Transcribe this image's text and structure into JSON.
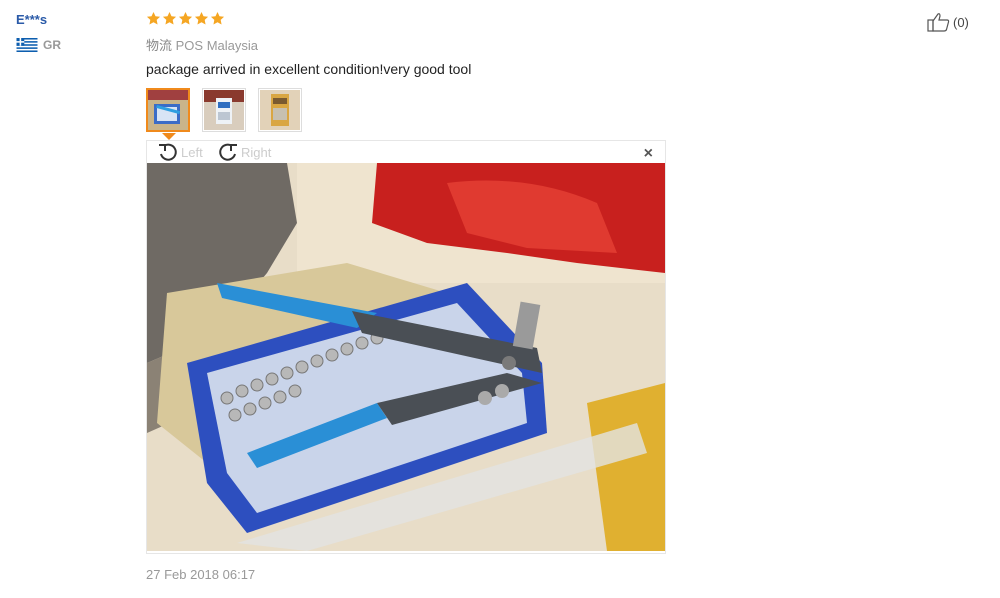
{
  "review": {
    "user_name": "E***s",
    "country_code": "GR",
    "rating": 5,
    "logistics_label": "物流",
    "logistics_value": "POS Malaysia",
    "text": "package arrived in excellent condition!very good tool",
    "date": "27 Feb 2018 06:17",
    "helpful_count": "(0)"
  },
  "viewer": {
    "rotate_left_label": "Left",
    "rotate_right_label": "Right",
    "close_label": "×"
  },
  "icons": {
    "flag": "greece-flag-icon",
    "star": "star-icon",
    "rotate_left": "rotate-left-icon",
    "rotate_right": "rotate-right-icon",
    "close": "close-icon",
    "thumbs_up": "thumbs-up-icon"
  },
  "colors": {
    "user_name": "#2a5aa8",
    "star": "#f5a623",
    "thumb_active_border": "#f08a1c"
  }
}
